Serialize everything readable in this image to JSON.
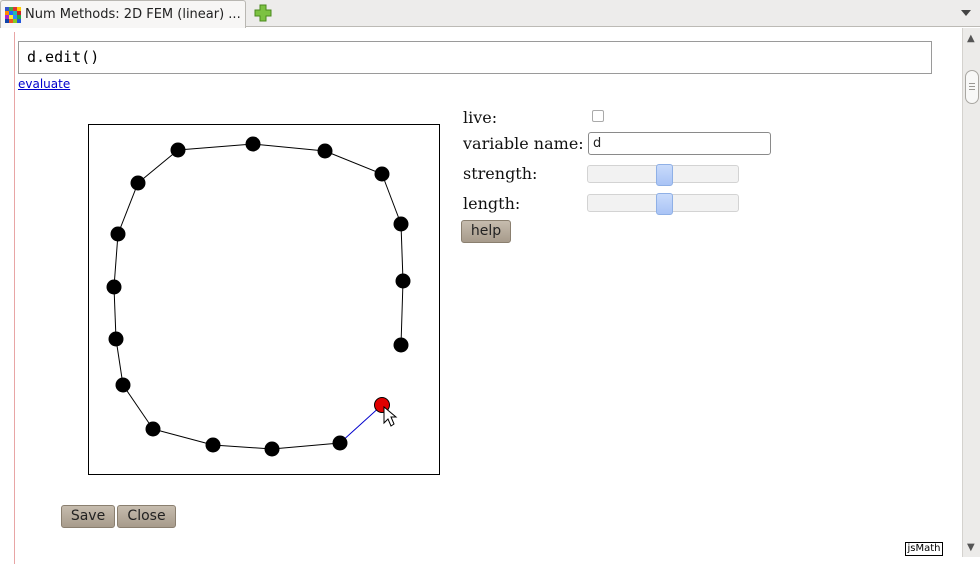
{
  "browser": {
    "tab_title": "Num Methods: 2D FEM (linear) ...",
    "new_tab_icon": "plus-icon",
    "tab_list_icon": "chevron-down-icon"
  },
  "cell": {
    "input_code": "d.edit()",
    "evaluate_label": "evaluate"
  },
  "controls": {
    "live_label": "live:",
    "live_checked": false,
    "variable_name_label": "variable name:",
    "variable_name_value": "d",
    "strength_label": "strength:",
    "strength_value": 0.5,
    "length_label": "length:",
    "length_value": 0.5,
    "help_label": "help"
  },
  "buttons": {
    "save_label": "Save",
    "close_label": "Close"
  },
  "footer": {
    "jsmath_label": "jsMath"
  },
  "colors": {
    "node": "#000000",
    "selected_node": "#e00000",
    "active_edge": "#0000cc",
    "button_bg": "#b3a898",
    "slider_handle": "#b9cffa"
  },
  "chain": {
    "selected_index": 17
  }
}
